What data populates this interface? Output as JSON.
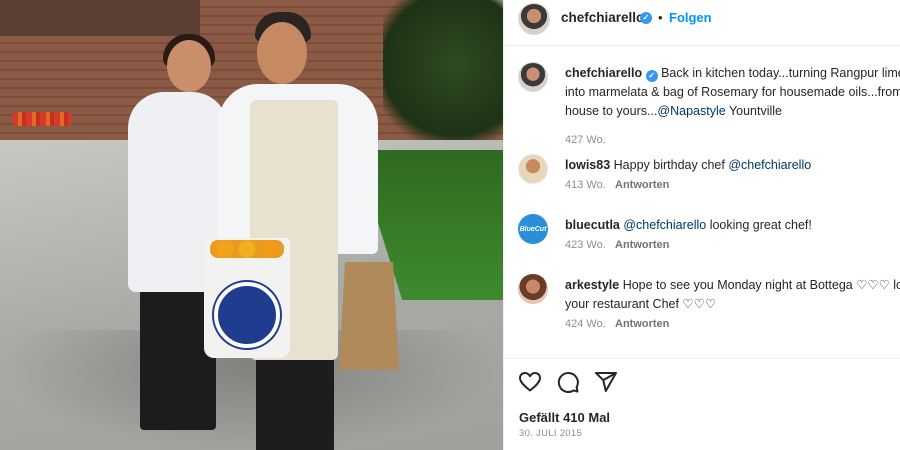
{
  "post": {
    "owner": {
      "username": "chefchiarello",
      "verified": true
    },
    "header": {
      "separator": "•",
      "follow_label": "Folgen"
    },
    "caption": {
      "username": "chefchiarello",
      "text_part1": "Back in kitchen today...turning Rangpur lime",
      "text_line2": "into marmelata & bag of Rosemary for housemade oils...from",
      "text_line3_prefix": "house to yours...",
      "mention": "@Napastyle",
      "text_line3_suffix": " Yountville",
      "age": "427 Wo."
    },
    "comments": [
      {
        "username": "lowis83",
        "text": "Happy birthday chef ",
        "mention": "@chefchiarello",
        "text_after": "",
        "age": "413 Wo.",
        "reply_label": "Antworten",
        "avatar_icon": "profile-photo"
      },
      {
        "username": "bluecutla",
        "text": "",
        "mention": "@chefchiarello",
        "text_after": " looking great chef!",
        "age": "423 Wo.",
        "reply_label": "Antworten",
        "avatar_icon": "bluecut-logo"
      },
      {
        "username": "arkestyle",
        "text": "Hope to see you Monday night at Bottega ♡♡♡ lo",
        "line2": "your restaurant Chef ♡♡♡",
        "age": "424 Wo.",
        "reply_label": "Antworten",
        "avatar_icon": "profile-photo"
      }
    ],
    "avatar_text_bluecut": "BlueCut",
    "likes": "Gefällt 410 Mal",
    "date": "30. JULI 2015",
    "icons": [
      "heart-icon",
      "comment-icon",
      "share-icon"
    ],
    "colors": {
      "follow": "#0095f6",
      "mention": "#00376b",
      "verified": "#3897f0",
      "muted": "#8e8e8e"
    }
  }
}
